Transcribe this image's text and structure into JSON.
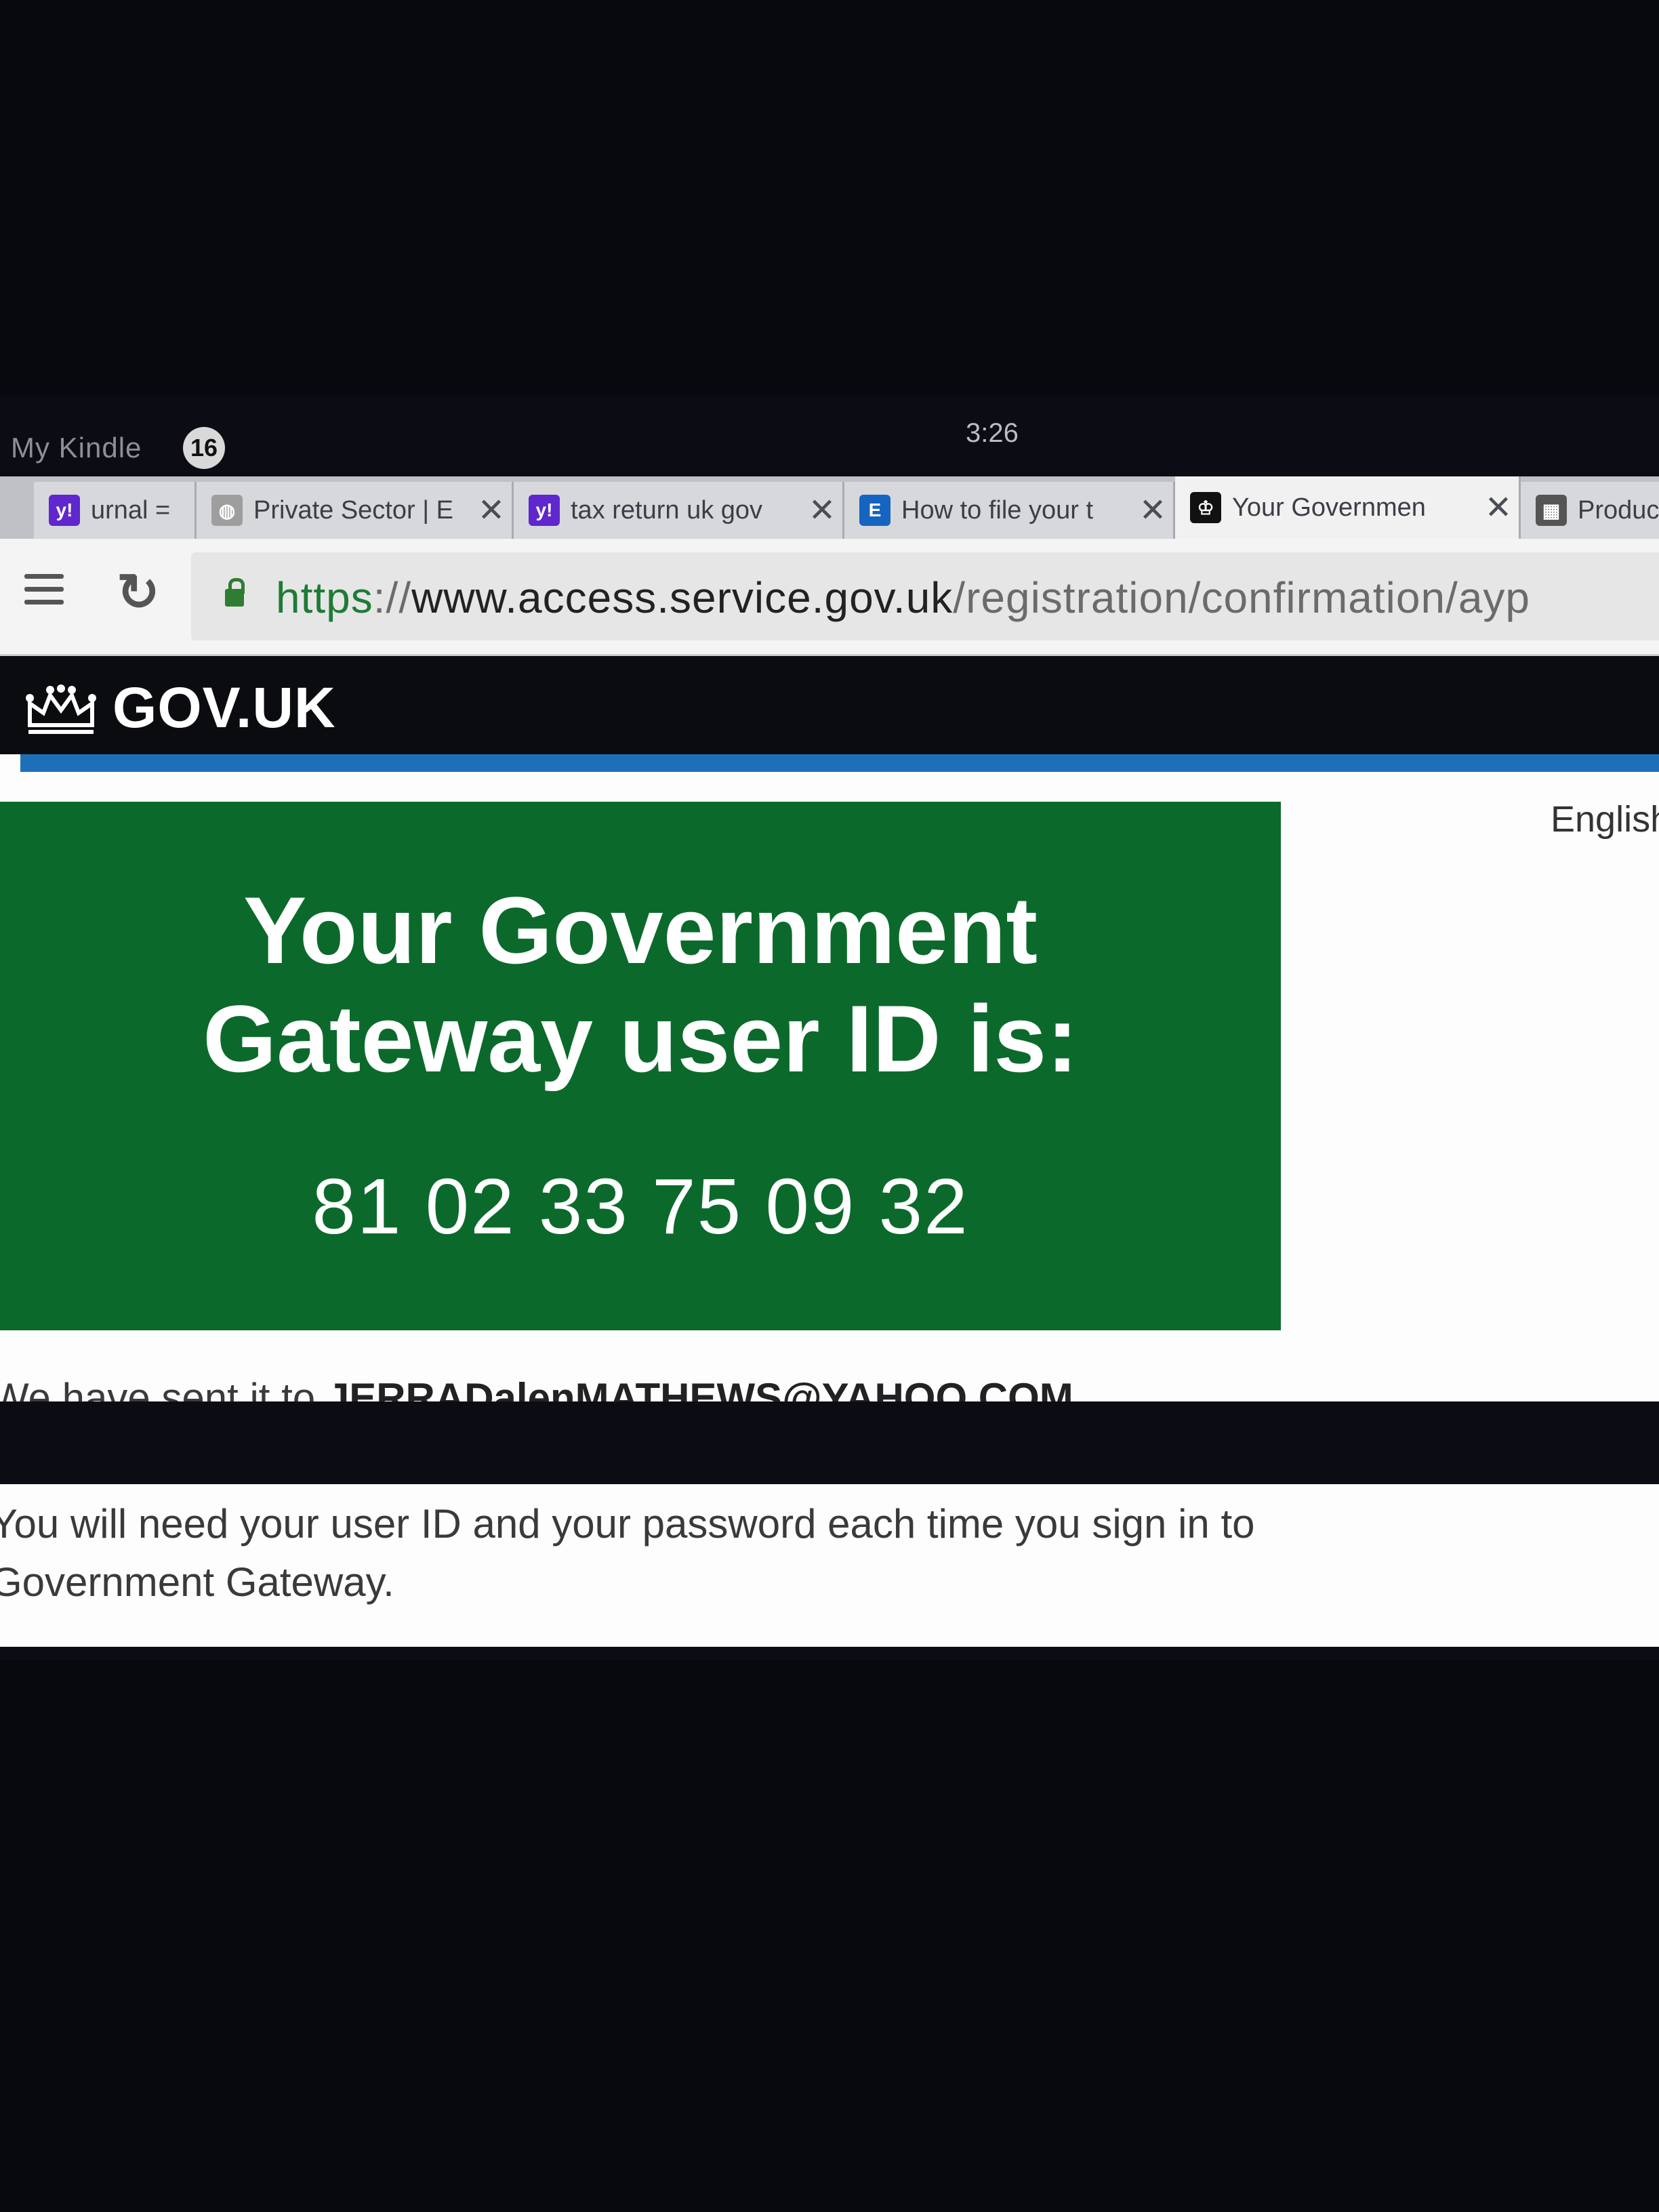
{
  "status_bar": {
    "app_label": "My Kindle",
    "notification_count": "16",
    "time": "3:26"
  },
  "tabs": [
    {
      "title": "urnal = ",
      "favicon_icon": "yahoo-icon",
      "favicon_text": "y!",
      "favicon_color": "#5f27cd",
      "closable": false
    },
    {
      "title": "Private Sector | E",
      "favicon_icon": "globe-icon",
      "favicon_text": "◍",
      "favicon_color": "#9e9e9e",
      "closable": true
    },
    {
      "title": "tax return uk gov",
      "favicon_icon": "yahoo-icon",
      "favicon_text": "y!",
      "favicon_color": "#5f27cd",
      "closable": true
    },
    {
      "title": "How to file your t",
      "favicon_icon": "letter-e-icon",
      "favicon_text": "E",
      "favicon_color": "#1565c0",
      "closable": true
    },
    {
      "title": "Your Governmen",
      "favicon_icon": "gov-crown-icon",
      "favicon_text": "♔",
      "favicon_color": "#111111",
      "closable": true,
      "active": true
    },
    {
      "title": "Produc",
      "favicon_icon": "grid-icon",
      "favicon_text": "▦",
      "favicon_color": "#555555",
      "closable": false
    }
  ],
  "address_bar": {
    "scheme": "https",
    "separator": "://",
    "host": "www.access.service.gov.uk",
    "path": "/registration/confirmation/ayp"
  },
  "header": {
    "logo_text": "GOV.UK"
  },
  "language_link": "English",
  "panel": {
    "title_line1": "Your Government",
    "title_line2": "Gateway user ID is:",
    "user_id": "81 02 33 75 09 32"
  },
  "body": {
    "sent_prefix": "We have sent it to ",
    "email": "JERRADalenMATHEWS@YAHOO.COM",
    "sent_suffix": ".",
    "instructions_line1": "You will need your user ID and your password each time you sign in to",
    "instructions_line2": "Government Gateway."
  },
  "colors": {
    "panel_green": "#0b6a2b",
    "gov_blue": "#1d70b8",
    "header_black": "#0b0c10",
    "secure_green": "#1e7b34"
  }
}
